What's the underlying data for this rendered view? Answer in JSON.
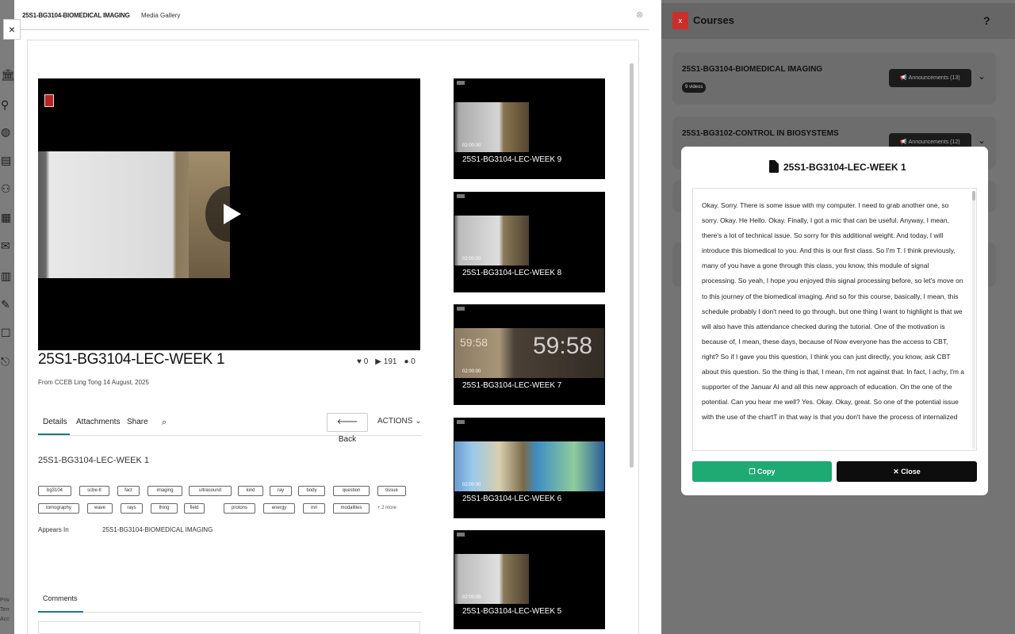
{
  "rail": {
    "icons": [
      "institution-icon",
      "user-icon",
      "globe-icon",
      "courses-icon",
      "groups-icon",
      "calendar-icon",
      "mail-icon",
      "grades-icon",
      "tools-icon",
      "edit-icon",
      "logout-icon"
    ],
    "footer": [
      "Priv",
      "Terr",
      "Acc"
    ]
  },
  "gallery": {
    "course_code": "25S1-BG3104-BIOMEDICAL IMAGING",
    "section": "Media Gallery",
    "close_symbol": "×",
    "video": {
      "title": "25S1-BG3104-LEC-WEEK 1",
      "likes": "0",
      "plays": "191",
      "comments": "0",
      "from": "From CCEB Ling Tong 14 August, 2025"
    },
    "tabs": [
      "Details",
      "Attachments",
      "Share"
    ],
    "back_label": "Back",
    "actions_label": "ACTIONS",
    "details_title": "25S1-BG3104-LEC-WEEK 1",
    "tags": [
      "bg3104",
      "scbe-lt",
      "fact",
      "imaging",
      "ultrasound",
      "kind",
      "ray",
      "body",
      "question",
      "tissue",
      "tomography",
      "wave",
      "rays",
      "thing",
      "field",
      "protons",
      "energy",
      "mri",
      "modalities"
    ],
    "more_tags": "+ 2 more",
    "appears_in_label": "Appears In",
    "appears_in_value": "25S1-BG3104-BIOMEDICAL IMAGING",
    "comments_label": "Comments",
    "playlist": [
      {
        "title": "25S1-BG3104-LEC-WEEK 9",
        "duration": "02:00:00"
      },
      {
        "title": "25S1-BG3104-LEC-WEEK 8",
        "duration": "02:00:00"
      },
      {
        "title": "25S1-BG3104-LEC-WEEK 7",
        "duration": "02:00:00"
      },
      {
        "title": "25S1-BG3104-LEC-WEEK 6",
        "duration": "02:00:00"
      },
      {
        "title": "25S1-BG3104-LEC-WEEK 5",
        "duration": "02:00:00"
      }
    ],
    "week7_clock": "59:58"
  },
  "courses": {
    "close_label": "x",
    "title": "Courses",
    "help": "?",
    "items": [
      {
        "name": "25S1-BG3104-BIOMEDICAL IMAGING",
        "badge": "9 videos",
        "announcements": "Announcements (13)"
      },
      {
        "name": "25S1-BG3102-CONTROL IN BIOSYSTEMS",
        "badge": "",
        "announcements": "Announcements (12)"
      }
    ]
  },
  "transcript_modal": {
    "title": "25S1-BG3104-LEC-WEEK 1",
    "text": "Okay. Sorry. There is some issue with my computer. I need to grab another one, so sorry. Okay. He Hello. Okay. Finally, I got a mic that can be useful. Anyway, I mean, there's a lot of technical issue. So sorry for this additional weight. And today, I will introduce this biomedical to you. And this is our first class. So I'm T. I think previously, many of you have a gone through this class, you know, this module of signal processing. So yeah, I hope you enjoyed this signal processing before, so let's move on to this journey of the biomedical imaging. And so for this course, basically, I mean, this schedule probably I don't need to go through, but one thing I want to highlight is that we will also have this attendance checked during the tutorial. One of the motivation is because of, I mean, these days, because of Now everyone has the access to CBT, right? So if I gave you this question, I think you can just directly, you know, ask CBT about this question. So the thing is that, I mean, I'm not against that. In fact, I achy, I'm a supporter of the Januar AI and all this new approach of education. On the one of the potential. Can you hear me well? Yes. Okay. Okay, great. So one of the potential issue with the use of the chartT in that way is that you don't have the process of internalized",
    "copy_label": "Copy",
    "close_label": "Close"
  }
}
